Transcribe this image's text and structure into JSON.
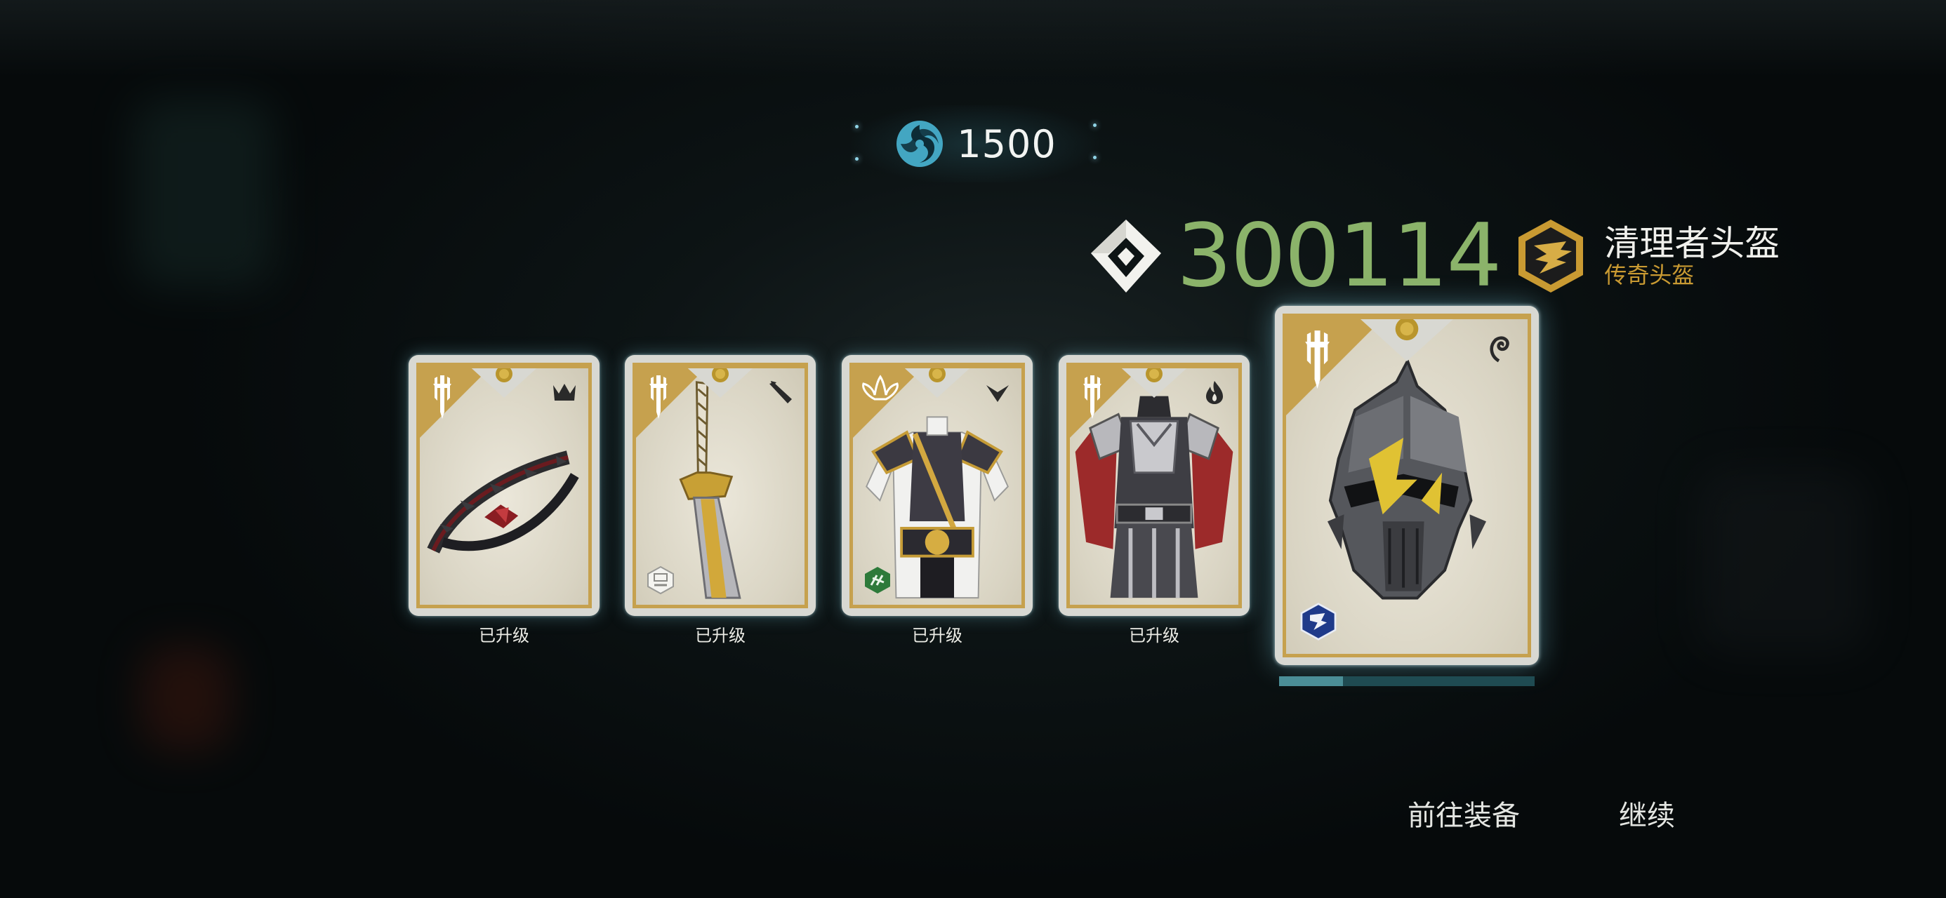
{
  "currency": {
    "icon": "swirl-currency-icon",
    "amount": "1500",
    "color": "#43a6c2"
  },
  "gear_score": {
    "icon": "gear-score-icon",
    "value": "300114",
    "color": "#8bb36a"
  },
  "item": {
    "name": "清理者头盔",
    "rarity": "传奇头盔",
    "rarity_color": "#c99a32",
    "badge_icon": "legendary-rarity-icon"
  },
  "cards": [
    {
      "corner_icon": "tier-sword-icon",
      "slot_icon": "crown-slot-icon",
      "bottom_icon": "",
      "art": "bow-item",
      "label": "已升级"
    },
    {
      "corner_icon": "tier-sword-icon",
      "slot_icon": "blade-slot-icon",
      "bottom_icon": "set-bonus-icon",
      "art": "greatsword-item",
      "label": "已升级"
    },
    {
      "corner_icon": "lotus-icon",
      "slot_icon": "chevron-slot-icon",
      "bottom_icon": "green-perk-icon",
      "art": "robe-armor-item",
      "label": "已升级"
    },
    {
      "corner_icon": "tier-sword-icon",
      "slot_icon": "flame-slot-icon",
      "bottom_icon": "",
      "art": "plate-armor-item",
      "label": "已升级"
    },
    {
      "corner_icon": "tier-sword-icon",
      "slot_icon": "spiral-slot-icon",
      "bottom_icon": "blue-perk-icon",
      "art": "helmet-item",
      "label": ""
    }
  ],
  "progress": {
    "fraction": 0.25
  },
  "actions": {
    "equip": "前往装备",
    "continue": "继续"
  },
  "colors": {
    "card_gold": "#c6a14e",
    "accent_blue": "#43a6c2"
  }
}
